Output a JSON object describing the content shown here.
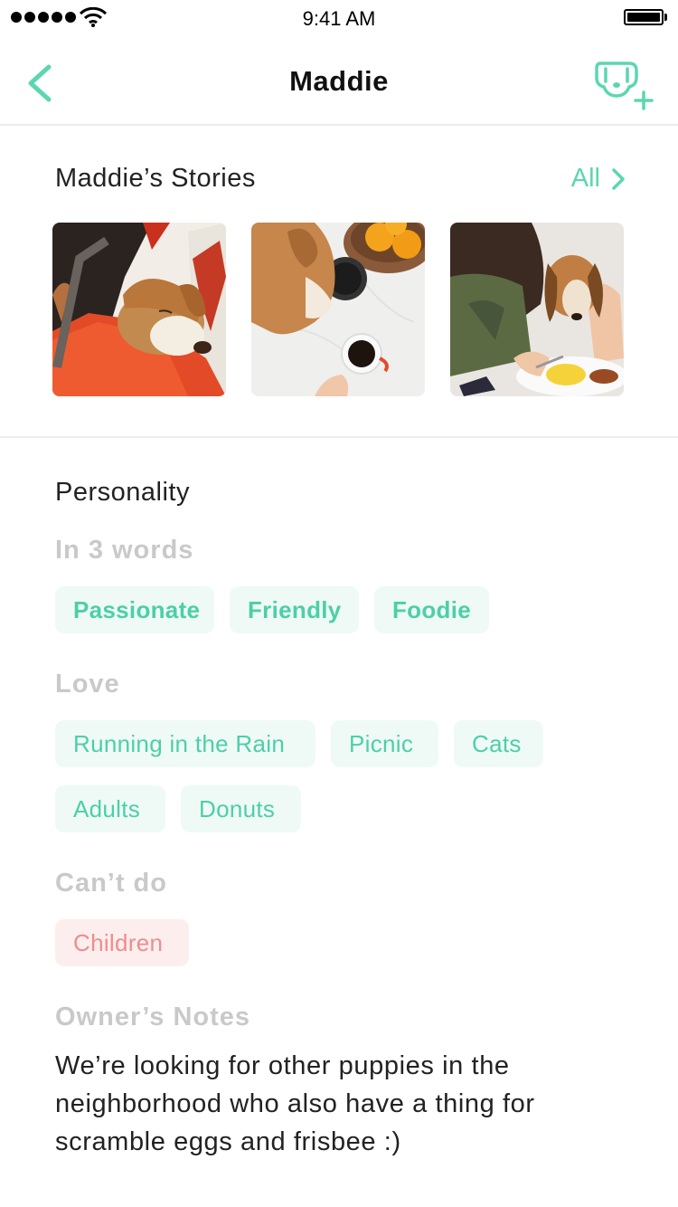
{
  "status_bar": {
    "time": "9:41 AM"
  },
  "nav": {
    "title": "Maddie"
  },
  "stories": {
    "title": "Maddie’s Stories",
    "all_label": "All",
    "items": [
      {
        "alt": "Dog sleeping on owner's shoulder in car"
      },
      {
        "alt": "Dog sniffing coffee mug on marble table"
      },
      {
        "alt": "Dog next to woman eating breakfast"
      }
    ]
  },
  "personality": {
    "title": "Personality",
    "in3words": {
      "label": "In 3 words",
      "tags": [
        "Passionate",
        "Friendly",
        "Foodie"
      ]
    },
    "love": {
      "label": "Love",
      "tags": [
        "Running in the Rain",
        "Picnic",
        "Cats",
        "Adults",
        "Donuts"
      ]
    },
    "cant_do": {
      "label": "Can’t do",
      "tags": [
        "Children"
      ]
    },
    "notes": {
      "label": "Owner’s Notes",
      "text": "We’re looking for other puppies in the neighborhood who also have a thing for scramble eggs and frisbee :)"
    }
  },
  "colors": {
    "accent": "#5cd6b2",
    "chip_bg": "#effaf6",
    "negative": "#f08c8c",
    "negative_bg": "#fdeeee",
    "muted": "#c9c9c9"
  },
  "icons": [
    "cellular-signal-icon",
    "wifi-icon",
    "battery-icon",
    "back-chevron-icon",
    "add-dog-icon",
    "chevron-right-icon"
  ]
}
